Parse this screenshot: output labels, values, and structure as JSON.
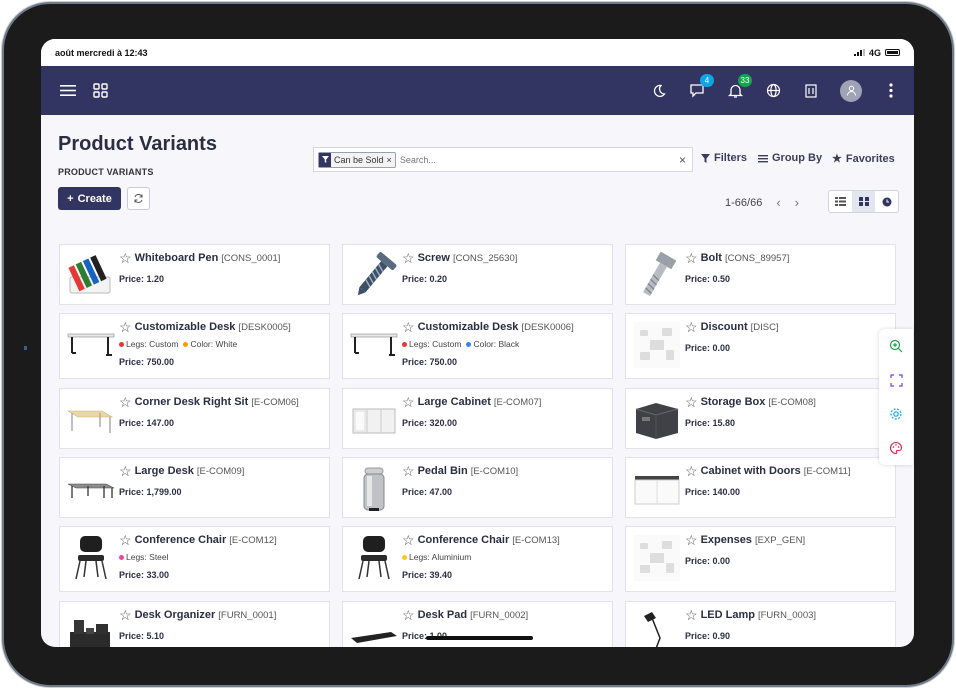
{
  "status_bar": {
    "time": "août mercredi à 12:43",
    "network": "4G"
  },
  "navbar": {
    "chat_badge": "4",
    "activity_badge": "33"
  },
  "control_panel": {
    "title": "Product Variants",
    "breadcrumb": "PRODUCT VARIANTS",
    "create_label": "Create",
    "search": {
      "facet": "Can be Sold",
      "placeholder": "Search..."
    },
    "filters_label": "Filters",
    "group_by_label": "Group By",
    "favorites_label": "Favorites",
    "pager": "1-66/66"
  },
  "products": [
    {
      "name": "Whiteboard Pen",
      "ref": "[CONS_0001]",
      "price": "Price: 1.20",
      "thumb": "pens"
    },
    {
      "name": "Screw",
      "ref": "[CONS_25630]",
      "price": "Price: 0.20",
      "thumb": "screw"
    },
    {
      "name": "Bolt",
      "ref": "[CONS_89957]",
      "price": "Price: 0.50",
      "thumb": "bolt"
    },
    {
      "name": "Customizable Desk",
      "ref": "[DESK0005]",
      "price": "Price: 750.00",
      "thumb": "desk",
      "attrs": [
        {
          "label": "Legs: Custom",
          "color": "#e53935"
        },
        {
          "label": "Color: White",
          "color": "#f59e0b"
        }
      ]
    },
    {
      "name": "Customizable Desk",
      "ref": "[DESK0006]",
      "price": "Price: 750.00",
      "thumb": "desk",
      "attrs": [
        {
          "label": "Legs: Custom",
          "color": "#e53935"
        },
        {
          "label": "Color: Black",
          "color": "#3b82f6"
        }
      ]
    },
    {
      "name": "Discount",
      "ref": "[DISC]",
      "price": "Price: 0.00",
      "thumb": "placeholder"
    },
    {
      "name": "Corner Desk Right Sit",
      "ref": "[E-COM06]",
      "price": "Price: 147.00",
      "thumb": "corner-desk"
    },
    {
      "name": "Large Cabinet",
      "ref": "[E-COM07]",
      "price": "Price: 320.00",
      "thumb": "cabinet"
    },
    {
      "name": "Storage Box",
      "ref": "[E-COM08]",
      "price": "Price: 15.80",
      "thumb": "box"
    },
    {
      "name": "Large Desk",
      "ref": "[E-COM09]",
      "price": "Price: 1,799.00",
      "thumb": "large-desk"
    },
    {
      "name": "Pedal Bin",
      "ref": "[E-COM10]",
      "price": "Price: 47.00",
      "thumb": "bin"
    },
    {
      "name": "Cabinet with Doors",
      "ref": "[E-COM11]",
      "price": "Price: 140.00",
      "thumb": "cabinet-doors"
    },
    {
      "name": "Conference Chair",
      "ref": "[E-COM12]",
      "price": "Price: 33.00",
      "thumb": "chair",
      "attrs": [
        {
          "label": "Legs: Steel",
          "color": "#ec4899"
        }
      ]
    },
    {
      "name": "Conference Chair",
      "ref": "[E-COM13]",
      "price": "Price: 39.40",
      "thumb": "chair",
      "attrs": [
        {
          "label": "Legs: Aluminium",
          "color": "#facc15"
        }
      ]
    },
    {
      "name": "Expenses",
      "ref": "[EXP_GEN]",
      "price": "Price: 0.00",
      "thumb": "placeholder"
    },
    {
      "name": "Desk Organizer",
      "ref": "[FURN_0001]",
      "price": "Price: 5.10",
      "thumb": "organizer"
    },
    {
      "name": "Desk Pad",
      "ref": "[FURN_0002]",
      "price": "Price: 1.00",
      "thumb": "pad"
    },
    {
      "name": "LED Lamp",
      "ref": "[FURN_0003]",
      "price": "Price: 0.90",
      "thumb": "lamp"
    }
  ]
}
